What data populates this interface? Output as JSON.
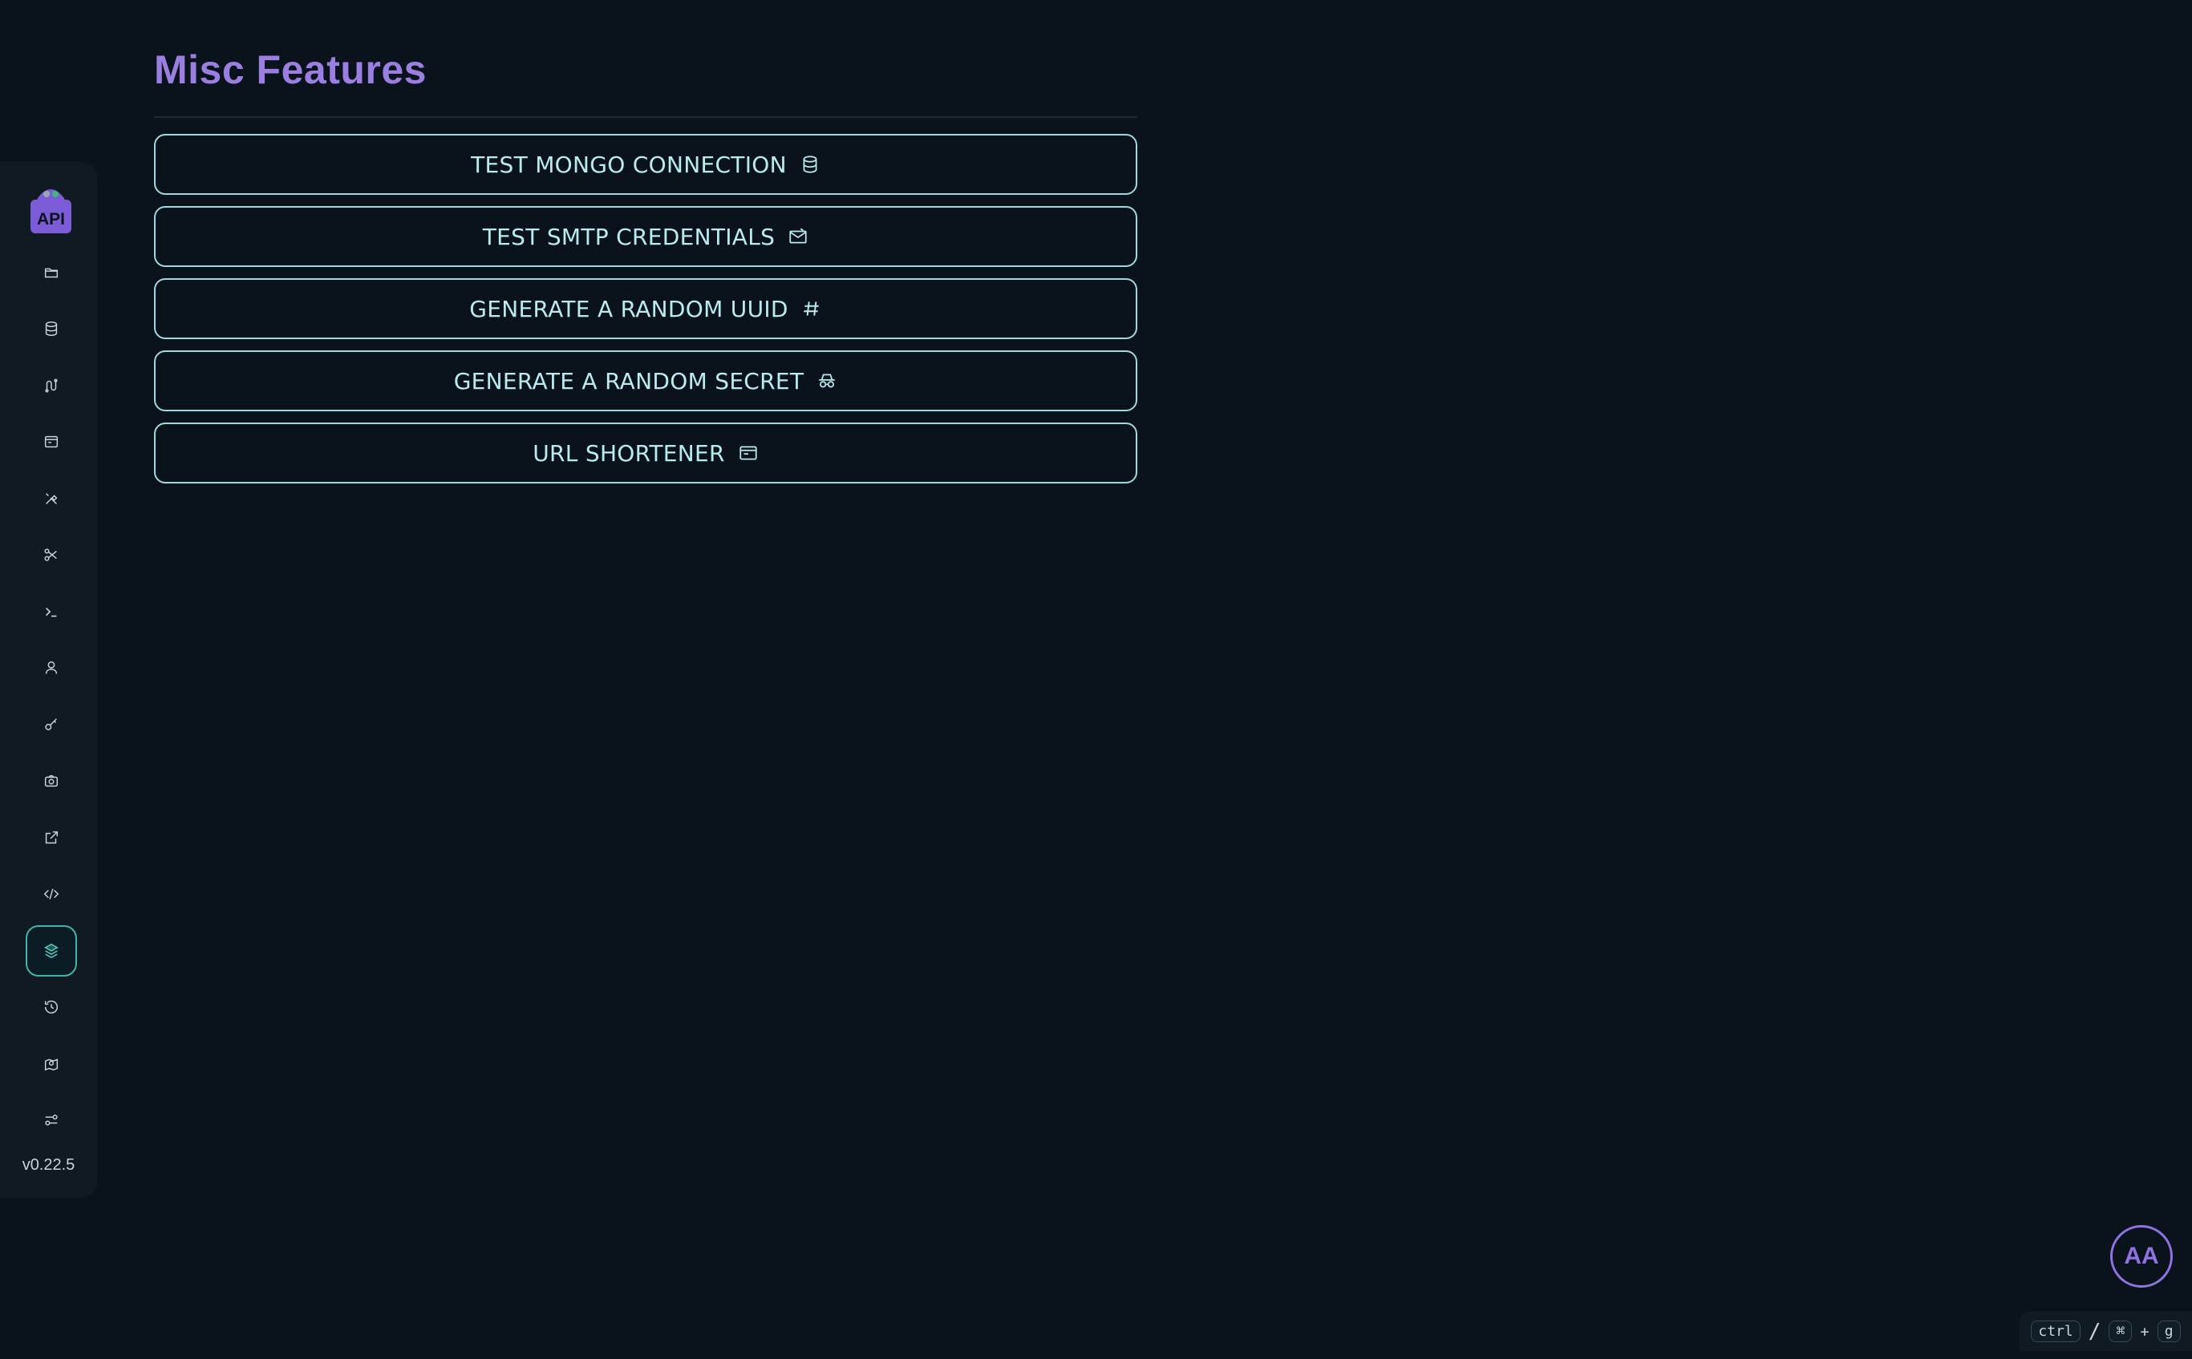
{
  "page": {
    "title": "Misc Features"
  },
  "features": [
    {
      "label": "TEST MONGO CONNECTION",
      "icon": "database-icon"
    },
    {
      "label": "TEST SMTP CREDENTIALS",
      "icon": "mail-icon"
    },
    {
      "label": "GENERATE A RANDOM UUID",
      "icon": "hash-icon"
    },
    {
      "label": "GENERATE A RANDOM SECRET",
      "icon": "incognito-icon"
    },
    {
      "label": "URL SHORTENER",
      "icon": "browser-window-icon"
    }
  ],
  "sidebar": {
    "logo_text": "API",
    "version": "v0.22.5",
    "items": [
      {
        "icon": "folder-icon"
      },
      {
        "icon": "database-icon"
      },
      {
        "icon": "routes-icon"
      },
      {
        "icon": "browser-window-icon"
      },
      {
        "icon": "tools-icon"
      },
      {
        "icon": "scissors-icon"
      },
      {
        "icon": "terminal-icon"
      },
      {
        "icon": "user-icon"
      },
      {
        "icon": "key-icon"
      },
      {
        "icon": "camera-icon"
      },
      {
        "icon": "external-link-icon"
      },
      {
        "icon": "code-icon"
      },
      {
        "icon": "layers-icon",
        "active": true
      },
      {
        "icon": "history-icon"
      },
      {
        "icon": "map-pin-icon"
      },
      {
        "icon": "settings-sliders-icon"
      }
    ]
  },
  "user": {
    "initials": "AA"
  },
  "shortcut": {
    "key1": "ctrl",
    "separator": "/",
    "key2": "⌘",
    "plus": "+",
    "key3": "g"
  },
  "colors": {
    "background": "#0a131c",
    "accent_purple": "#9b7fe0",
    "accent_teal": "#4fd1c1",
    "button_border": "#9fd9e0"
  }
}
